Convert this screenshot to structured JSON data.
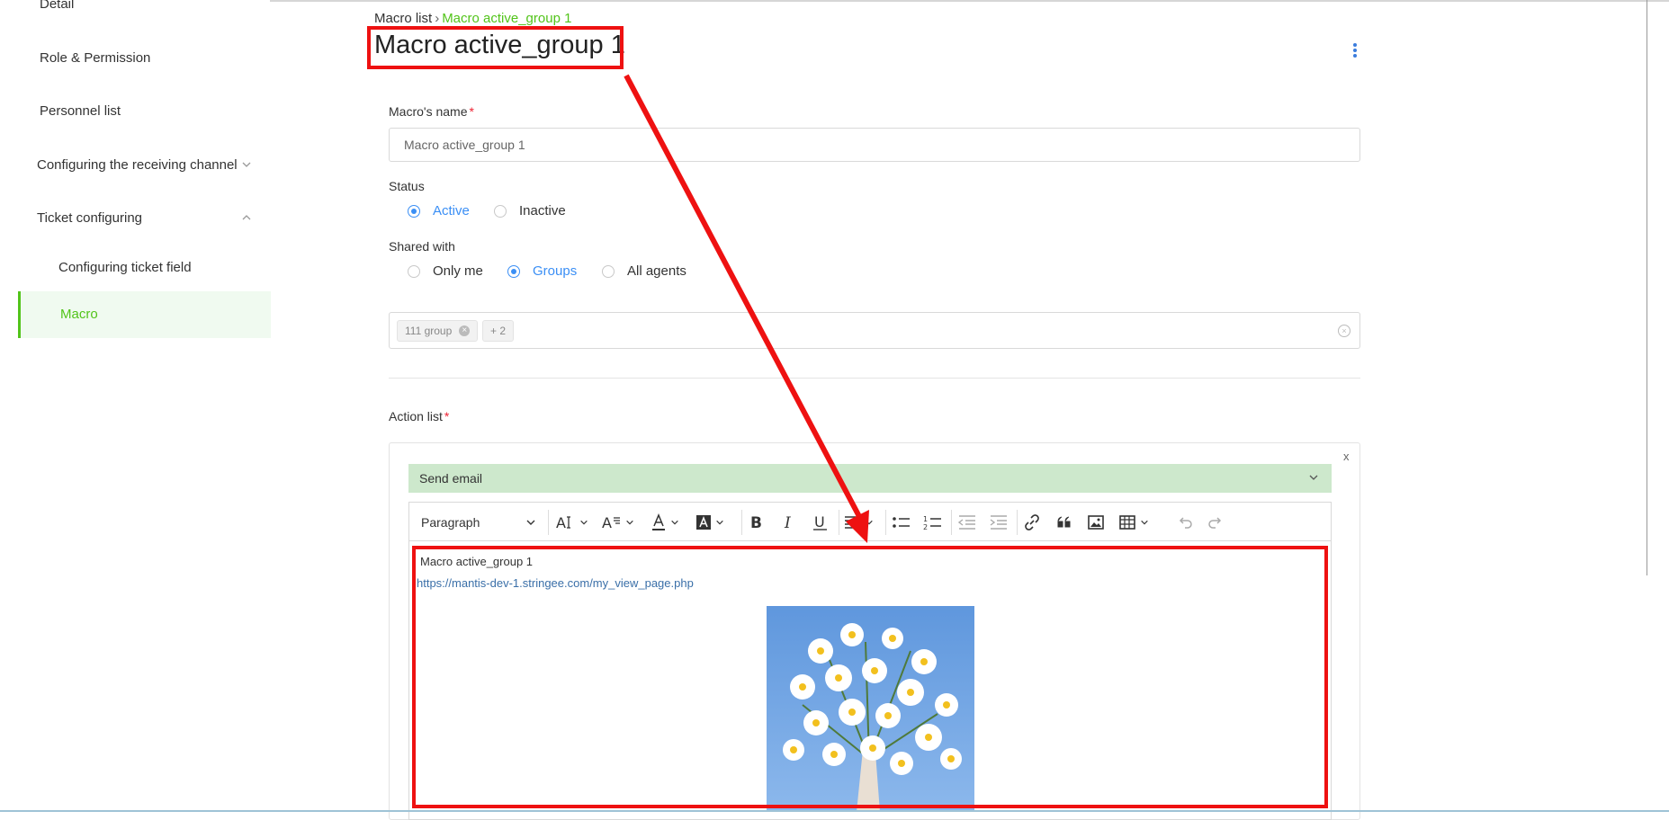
{
  "sidebar": {
    "items": [
      {
        "label": "Detail"
      },
      {
        "label": "Role & Permission"
      },
      {
        "label": "Personnel list"
      },
      {
        "label": "Configuring the receiving channel"
      },
      {
        "label": "Ticket configuring"
      },
      {
        "label": "Configuring ticket field"
      },
      {
        "label": "Macro"
      }
    ]
  },
  "breadcrumb": {
    "parent": "Macro list",
    "separator": "›",
    "current": "Macro active_group 1"
  },
  "page": {
    "title": "Macro active_group 1"
  },
  "form": {
    "name_label": "Macro's name",
    "required_mark": "*",
    "name_value": "Macro active_group 1",
    "status_label": "Status",
    "status_options": [
      "Active",
      "Inactive"
    ],
    "status_selected": "Active",
    "shared_label": "Shared with",
    "shared_options": [
      "Only me",
      "Groups",
      "All agents"
    ],
    "shared_selected": "Groups",
    "group_tags": [
      "111 group",
      "+ 2"
    ],
    "action_label": "Action list"
  },
  "action": {
    "close_label": "x",
    "type": "Send email",
    "toolbar": {
      "paragraph": "Paragraph"
    },
    "editor": {
      "line1": "Macro active_group 1",
      "link": "https://mantis-dev-1.stringee.com/my_view_page.php"
    }
  },
  "colors": {
    "accent": "#52c41a",
    "primary": "#3b8ff5",
    "annotation": "#ee1111",
    "email_bar": "#cde8cc"
  }
}
